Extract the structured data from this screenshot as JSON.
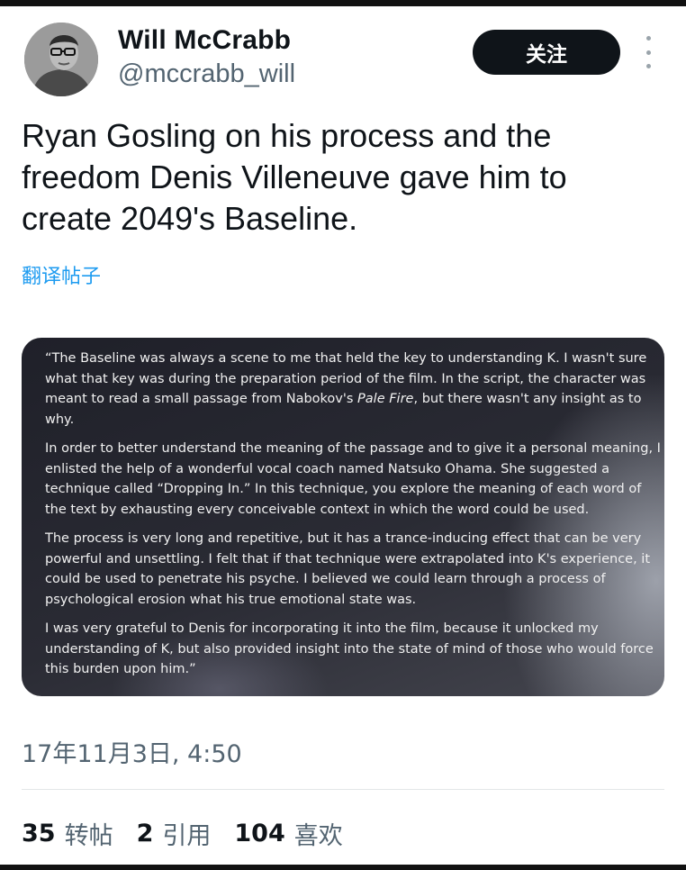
{
  "author": {
    "name": "Will McCrabb",
    "handle": "@mccrabb_will"
  },
  "follow_button": {
    "label": "关注"
  },
  "tweet": {
    "text": "Ryan Gosling on his process and the freedom Denis Villeneuve gave him to create 2049's Baseline.",
    "translate_label": "翻译帖子"
  },
  "media": {
    "paragraphs": [
      {
        "before": "“The Baseline was always a scene to me that held the key to understanding K. I wasn't sure what that key was during the preparation period of the film. In the script, the character was meant to read a small passage from Nabokov's ",
        "italic": "Pale Fire",
        "after": ", but there wasn't any insight as to why."
      },
      {
        "text": "In order to better understand the meaning of the passage and to give it a personal meaning, I enlisted the help of a wonderful vocal coach named Natsuko Ohama. She suggested a technique called “Dropping In.” In this technique, you explore the meaning of each word of the text by exhausting every conceivable context in which the word could be used."
      },
      {
        "text": "The process is very long and repetitive, but it has a trance-inducing effect that can be very powerful and unsettling. I felt that if that technique were extrapolated into K's experience, it could be used to penetrate his psyche. I believed we could learn through a process of psychological erosion what his true emotional state was."
      },
      {
        "text": "I was very grateful to Denis for incorporating it into the film, because it unlocked my understanding of K, but also provided insight into the state of mind of those who would force this burden upon him.”"
      }
    ]
  },
  "timestamp": "17年11月3日, 4:50",
  "stats": {
    "retweets": {
      "count": "35",
      "label": "转帖"
    },
    "quotes": {
      "count": "2",
      "label": "引用"
    },
    "likes": {
      "count": "104",
      "label": "喜欢"
    }
  }
}
